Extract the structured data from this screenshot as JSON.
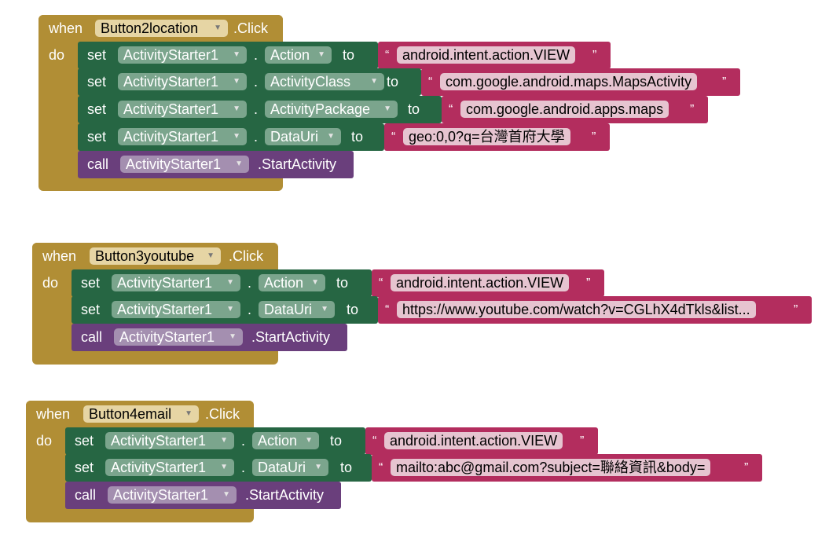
{
  "events": [
    {
      "when_label": "when",
      "component": "Button2location",
      "event_suffix": ".Click",
      "do_label": "do",
      "statements": [
        {
          "kind": "set",
          "set_label": "set",
          "component": "ActivityStarter1",
          "dot": ".",
          "property": "Action",
          "to_label": "to",
          "value": "android.intent.action.VIEW"
        },
        {
          "kind": "set",
          "set_label": "set",
          "component": "ActivityStarter1",
          "dot": ".",
          "property": "ActivityClass",
          "to_label": "to",
          "value": "com.google.android.maps.MapsActivity"
        },
        {
          "kind": "set",
          "set_label": "set",
          "component": "ActivityStarter1",
          "dot": ".",
          "property": "ActivityPackage",
          "to_label": "to",
          "value": "com.google.android.apps.maps"
        },
        {
          "kind": "set",
          "set_label": "set",
          "component": "ActivityStarter1",
          "dot": ".",
          "property": "DataUri",
          "to_label": "to",
          "value": "geo:0,0?q=台灣首府大學"
        },
        {
          "kind": "call",
          "call_label": "call",
          "component": "ActivityStarter1",
          "method": ".StartActivity"
        }
      ]
    },
    {
      "when_label": "when",
      "component": "Button3youtube",
      "event_suffix": ".Click",
      "do_label": "do",
      "statements": [
        {
          "kind": "set",
          "set_label": "set",
          "component": "ActivityStarter1",
          "dot": ".",
          "property": "Action",
          "to_label": "to",
          "value": "android.intent.action.VIEW"
        },
        {
          "kind": "set",
          "set_label": "set",
          "component": "ActivityStarter1",
          "dot": ".",
          "property": "DataUri",
          "to_label": "to",
          "value": "https://www.youtube.com/watch?v=CGLhX4dTkls&list..."
        },
        {
          "kind": "call",
          "call_label": "call",
          "component": "ActivityStarter1",
          "method": ".StartActivity"
        }
      ]
    },
    {
      "when_label": "when",
      "component": "Button4email",
      "event_suffix": ".Click",
      "do_label": "do",
      "statements": [
        {
          "kind": "set",
          "set_label": "set",
          "component": "ActivityStarter1",
          "dot": ".",
          "property": "Action",
          "to_label": "to",
          "value": "android.intent.action.VIEW"
        },
        {
          "kind": "set",
          "set_label": "set",
          "component": "ActivityStarter1",
          "dot": ".",
          "property": "DataUri",
          "to_label": "to",
          "value": "mailto:abc@gmail.com?subject=聯絡資訊&body="
        },
        {
          "kind": "call",
          "call_label": "call",
          "component": "ActivityStarter1",
          "method": ".StartActivity"
        }
      ]
    }
  ],
  "quote_open": "“",
  "quote_close": "”",
  "dropdown_icon": "triangle-down-icon",
  "colors": {
    "event_block": "#b18e35",
    "setter_block": "#266643",
    "call_block": "#6a3f7c",
    "text_block": "#b32d5e"
  }
}
